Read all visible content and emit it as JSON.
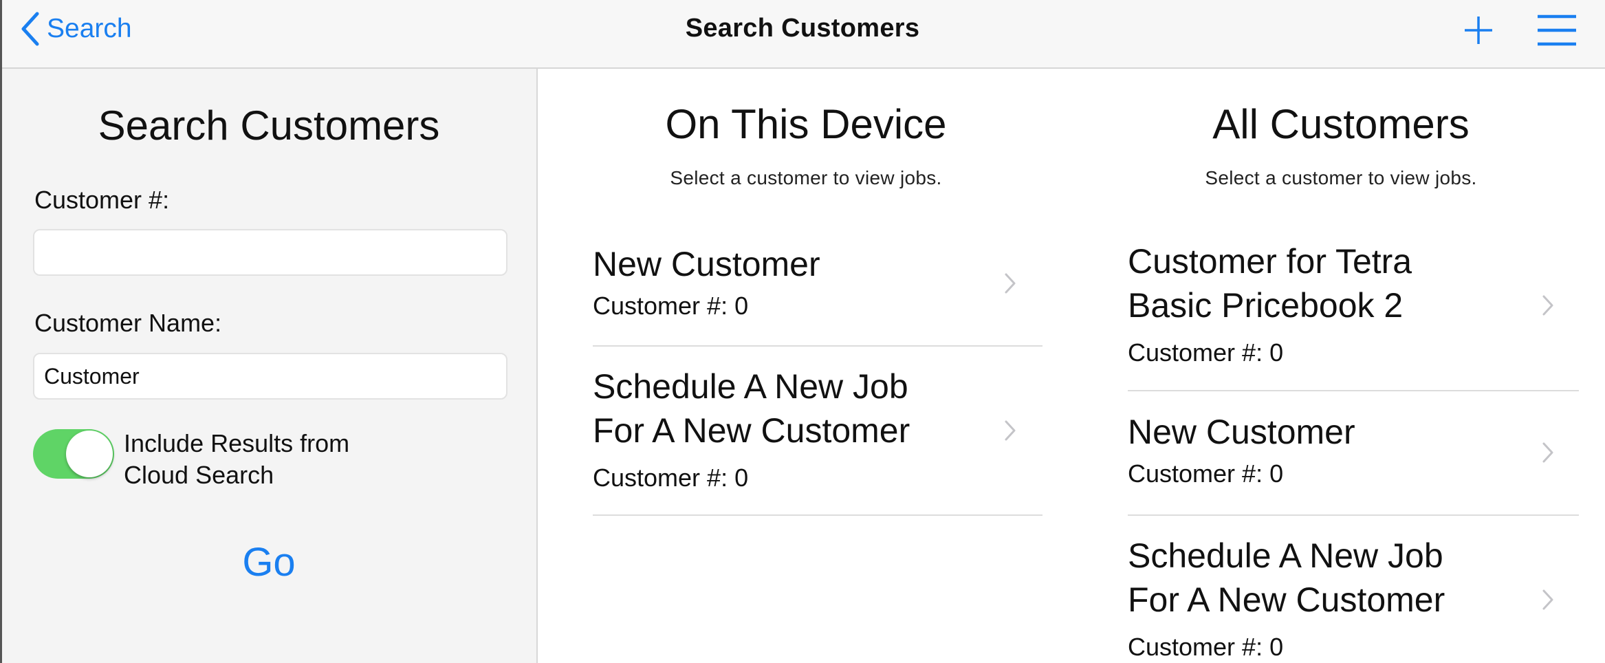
{
  "nav": {
    "back_label": "Search",
    "title": "Search Customers",
    "accent": "#1a7ff0",
    "icons": [
      "chevron-left-icon",
      "plus-icon",
      "menu-icon"
    ]
  },
  "search_form": {
    "title": "Search Customers",
    "customer_number_label": "Customer #:",
    "customer_number_value": "",
    "customer_name_label": "Customer Name:",
    "customer_name_value": "Customer",
    "toggle_on": true,
    "toggle_line1": "Include Results from",
    "toggle_line2": "Cloud Search",
    "toggle_color": "#5fd466",
    "go_label": "Go"
  },
  "on_device": {
    "title": "On This Device",
    "subtitle": "Select a customer to view jobs.",
    "items": [
      {
        "name_lines": [
          "New Customer"
        ],
        "number": "Customer #: 0"
      },
      {
        "name_lines": [
          "Schedule A New Job",
          "For A New Customer"
        ],
        "number": "Customer #: 0"
      }
    ]
  },
  "all_customers": {
    "title": "All Customers",
    "subtitle": "Select a customer to view jobs.",
    "items": [
      {
        "name_lines": [
          "Customer for Tetra",
          "Basic Pricebook 2"
        ],
        "number": "Customer #: 0"
      },
      {
        "name_lines": [
          "New Customer"
        ],
        "number": "Customer #: 0"
      },
      {
        "name_lines": [
          "Schedule A New Job",
          "For A New Customer"
        ],
        "number": "Customer #: 0"
      }
    ]
  }
}
